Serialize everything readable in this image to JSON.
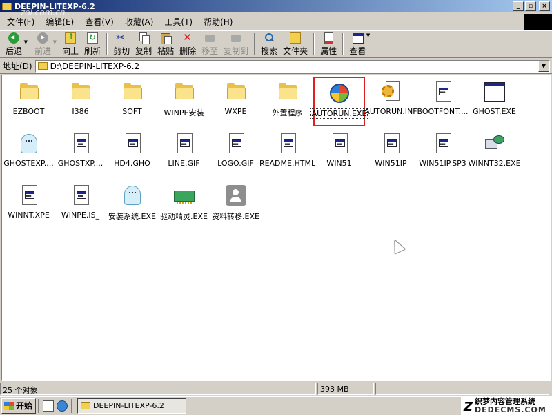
{
  "window": {
    "title": "DEEPIN-LITEXP-6.2",
    "controls": [
      "_",
      "▫",
      "×"
    ]
  },
  "watermark": "zol.com.cn",
  "menubar": {
    "items": [
      "文件(F)",
      "编辑(E)",
      "查看(V)",
      "收藏(A)",
      "工具(T)",
      "帮助(H)"
    ]
  },
  "toolbar": {
    "back": "后退",
    "forward": "前进",
    "up": "向上",
    "refresh": "刷新",
    "cut": "剪切",
    "copy": "复制",
    "paste": "粘贴",
    "delete": "删除",
    "move_to": "移至",
    "copy_to": "复制到",
    "search": "搜索",
    "folders": "文件夹",
    "properties": "属性",
    "views": "查看"
  },
  "address": {
    "label": "地址(D)",
    "path": "D:\\DEEPIN-LITEXP-6.2"
  },
  "files": [
    {
      "name": "EZBOOT",
      "icon": "folder-icon"
    },
    {
      "name": "I386",
      "icon": "folder-icon"
    },
    {
      "name": "SOFT",
      "icon": "folder-icon"
    },
    {
      "name": "WINPE安装",
      "icon": "folder-icon"
    },
    {
      "name": "WXPE",
      "icon": "folder-icon"
    },
    {
      "name": "外置程序",
      "icon": "folder-icon"
    },
    {
      "name": "AUTORUN.EXE",
      "icon": "windows-orb-icon",
      "highlighted": true
    },
    {
      "name": "AUTORUN.INF",
      "icon": "gear-document-icon"
    },
    {
      "name": "BOOTFONT....",
      "icon": "file-icon"
    },
    {
      "name": "GHOST.EXE",
      "icon": "app-window-icon"
    },
    {
      "name": "GHOSTEXP....",
      "icon": "ghost-icon"
    },
    {
      "name": "GHOSTXP....",
      "icon": "file-icon"
    },
    {
      "name": "HD4.GHO",
      "icon": "file-icon"
    },
    {
      "name": "LINE.GIF",
      "icon": "file-icon"
    },
    {
      "name": "LOGO.GIF",
      "icon": "file-icon"
    },
    {
      "name": "README.HTML",
      "icon": "file-icon"
    },
    {
      "name": "WIN51",
      "icon": "file-icon"
    },
    {
      "name": "WIN51IP",
      "icon": "file-icon"
    },
    {
      "name": "WIN51IP.SP3",
      "icon": "file-icon"
    },
    {
      "name": "WINNT32.EXE",
      "icon": "network-computer-icon"
    },
    {
      "name": "WINNT.XPE",
      "icon": "file-icon"
    },
    {
      "name": "WINPE.IS_",
      "icon": "file-icon"
    },
    {
      "name": "安装系统.EXE",
      "icon": "ghost-icon"
    },
    {
      "name": "驱动精灵.EXE",
      "icon": "circuit-card-icon"
    },
    {
      "name": "资料转移.EXE",
      "icon": "person-add-icon"
    }
  ],
  "statusbar": {
    "count": "25 个对象",
    "size": "393 MB"
  },
  "taskbar": {
    "start": "开始",
    "task": "DEEPIN-LITEXP-6.2",
    "tray_text": "织梦内容管理系统",
    "tray_sub": "DEDECMS.COM",
    "tray_logo": "Z"
  }
}
